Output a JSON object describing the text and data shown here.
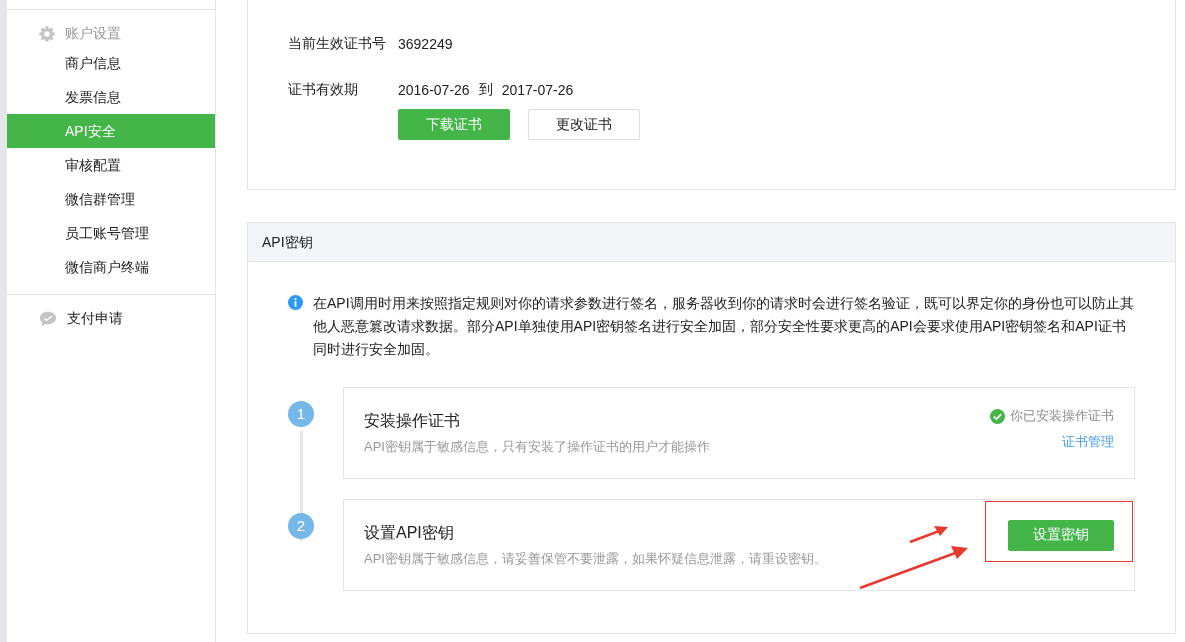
{
  "sidebar": {
    "groups": [
      {
        "title": "账户设置",
        "items": [
          {
            "label": "商户信息",
            "selected": false
          },
          {
            "label": "发票信息",
            "selected": false
          },
          {
            "label": "API安全",
            "selected": true
          },
          {
            "label": "审核配置",
            "selected": false
          },
          {
            "label": "微信群管理",
            "selected": false
          },
          {
            "label": "员工账号管理",
            "selected": false
          },
          {
            "label": "微信商户终端",
            "selected": false
          }
        ]
      },
      {
        "title": "支付申请"
      }
    ]
  },
  "certificate": {
    "fields": [
      {
        "label": "当前生效证书号",
        "values": [
          "3692249"
        ]
      },
      {
        "label": "证书有效期",
        "values": [
          "2016-07-26",
          "到",
          "2017-07-26"
        ]
      }
    ],
    "buttons": [
      {
        "label": "下载证书",
        "kind": "primary"
      },
      {
        "label": "更改证书",
        "kind": "default"
      }
    ]
  },
  "api_key": {
    "title": "API密钥",
    "notice": "在API调用时用来按照指定规则对你的请求参数进行签名，服务器收到你的请求时会进行签名验证，既可以界定你的身份也可以防止其他人恶意篡改请求数据。部分API单独使用API密钥签名进行安全加固，部分安全性要求更高的API会要求使用API密钥签名和API证书同时进行安全加固。",
    "steps": [
      {
        "number": "1",
        "title": "安装操作证书",
        "description": "API密钥属于敏感信息，只有安装了操作证书的用户才能操作",
        "kind": "status",
        "status": "你已安装操作证书",
        "link": "证书管理"
      },
      {
        "number": "2",
        "title": "设置API密钥",
        "description": "API密钥属于敏感信息，请妥善保管不要泄露，如果怀疑信息泄露，请重设密钥。",
        "kind": "button",
        "button": "设置密钥"
      }
    ]
  }
}
